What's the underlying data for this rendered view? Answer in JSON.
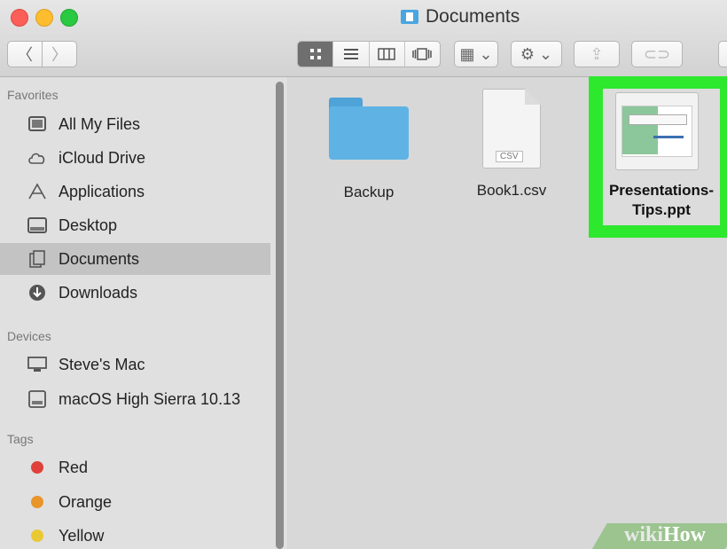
{
  "window": {
    "title": "Documents"
  },
  "toolbar": {
    "back_label": "〈",
    "forward_label": "〉",
    "view_icons": [
      "grid",
      "list",
      "columns",
      "coverflow"
    ],
    "arrange_label": "▦ ⌄",
    "action_label": "⚙ ⌄",
    "share_label": "⇪",
    "tags_label": "⊂⊃"
  },
  "sidebar": {
    "favorites_header": "Favorites",
    "favorites": [
      {
        "label": "All My Files",
        "icon": "all-files-icon"
      },
      {
        "label": "iCloud Drive",
        "icon": "cloud-icon"
      },
      {
        "label": "Applications",
        "icon": "applications-icon"
      },
      {
        "label": "Desktop",
        "icon": "desktop-icon"
      },
      {
        "label": "Documents",
        "icon": "documents-icon",
        "selected": true
      },
      {
        "label": "Downloads",
        "icon": "downloads-icon"
      }
    ],
    "devices_header": "Devices",
    "devices": [
      {
        "label": "Steve's Mac",
        "icon": "computer-icon"
      },
      {
        "label": "macOS High Sierra 10.13",
        "icon": "disk-icon"
      }
    ],
    "tags_header": "Tags",
    "tags": [
      {
        "label": "Red",
        "color": "#e0403a"
      },
      {
        "label": "Orange",
        "color": "#e8952a"
      },
      {
        "label": "Yellow",
        "color": "#e9c933"
      }
    ]
  },
  "files": [
    {
      "name": "Backup",
      "type": "folder"
    },
    {
      "name": "Book1.csv",
      "type": "csv",
      "badge": "CSV"
    },
    {
      "name_line1": "Presentations-",
      "name_line2": "Tips.ppt",
      "type": "ppt",
      "highlighted": true
    }
  ],
  "colors": {
    "highlight": "#2ee82e",
    "folder": "#5fb3e4"
  },
  "watermark": {
    "part1": "wiki",
    "part2": "How"
  }
}
